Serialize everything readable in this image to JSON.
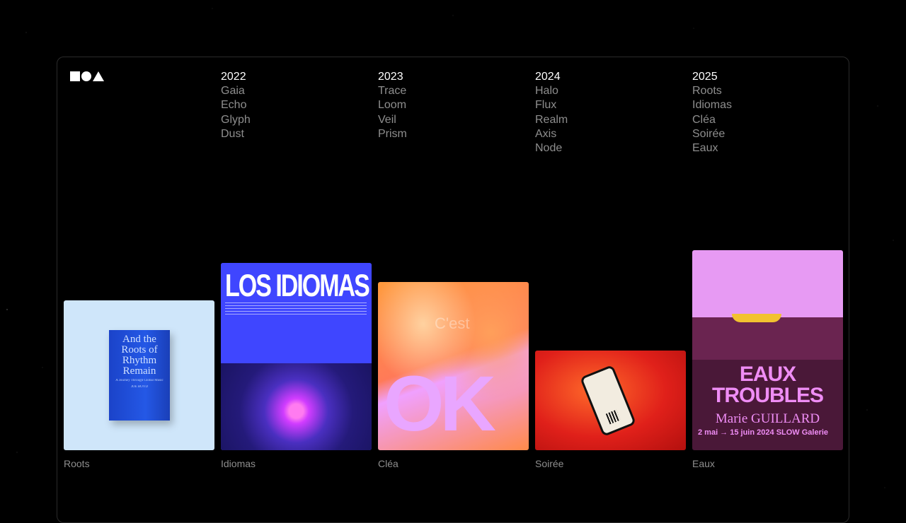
{
  "brand": {
    "logo_icon": "square-circle-triangle-logo"
  },
  "timeline": [
    {
      "year": "2022",
      "items": [
        "Gaia",
        "Echo",
        "Glyph",
        "Dust"
      ]
    },
    {
      "year": "2023",
      "items": [
        "Trace",
        "Loom",
        "Veil",
        "Prism"
      ]
    },
    {
      "year": "2024",
      "items": [
        "Halo",
        "Flux",
        "Realm",
        "Axis",
        "Node"
      ]
    },
    {
      "year": "2025",
      "items": [
        "Roots",
        "Idiomas",
        "Cléa",
        "Soirée",
        "Eaux"
      ]
    }
  ],
  "projects": [
    {
      "caption": "Roots",
      "book_title": "And the Roots of Rhythm Remain",
      "book_subtitle": "A Journey Through Global Music",
      "book_author": "JOE BOYD"
    },
    {
      "caption": "Idiomas",
      "poster_title": "LOS IDIOMAS"
    },
    {
      "caption": "Cléa",
      "poster_text": "C'est",
      "poster_big": "OK"
    },
    {
      "caption": "Soirée"
    },
    {
      "caption": "Eaux",
      "poster_title_1": "EAUX",
      "poster_title_2": "TROUBLES",
      "poster_artist": "Marie GUILLARD",
      "poster_dates": "2 mai → 15 juin 2024",
      "poster_venue": "SLOW Galerie"
    }
  ]
}
